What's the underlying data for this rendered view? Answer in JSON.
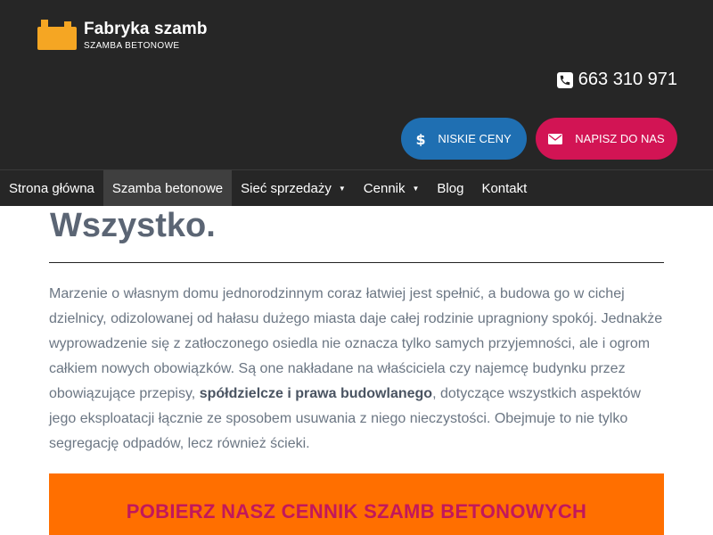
{
  "brand": {
    "title": "Fabryka szamb",
    "subtitle": "SZAMBA BETONOWE",
    "color": "#f5a623"
  },
  "contact": {
    "phone": "663 310 971",
    "icon": "phone-icon"
  },
  "buttons": {
    "prices_label": "NISKIE CENY",
    "prices_icon": "dollar-icon",
    "prices_color": "#1f6fb2",
    "write_label": "NAPISZ DO NAS",
    "write_icon": "envelope-icon",
    "write_color": "#d21454"
  },
  "nav": {
    "items": [
      {
        "label": "Strona główna",
        "dropdown": false,
        "active": false
      },
      {
        "label": "Szamba betonowe",
        "dropdown": false,
        "active": true
      },
      {
        "label": "Sieć sprzedaży",
        "dropdown": true,
        "active": false
      },
      {
        "label": "Cennik",
        "dropdown": true,
        "active": false
      },
      {
        "label": "Blog",
        "dropdown": false,
        "active": false
      },
      {
        "label": "Kontakt",
        "dropdown": false,
        "active": false
      }
    ]
  },
  "main": {
    "heading": "Wszystko.",
    "paragraph": {
      "part1": "Marzenie o własnym domu jednorodzinnym coraz łatwiej jest spełnić, a budowa go w cichej dzielnicy, odizolowanej od hałasu dużego miasta daje całej rodzinie upragniony spokój. Jednakże wyprowadzenie się z zatłoczonego osiedla nie oznacza tylko samych przyjemności, ale i ogrom całkiem nowych obowiązków. Są one nakładane na właściciela czy najemcę budynku przez obowiązujące przepisy, ",
      "bold": "spółdzielcze i prawa budowlanego",
      "part2": ", dotyczące wszystkich aspektów jego eksploatacji łącznie ze sposobem usuwania z niego nieczystości. Obejmuje to nie tylko segregację odpadów, lecz również ścieki."
    },
    "cta": "POBIERZ NASZ CENNIK SZAMB BETONOWYCH"
  }
}
